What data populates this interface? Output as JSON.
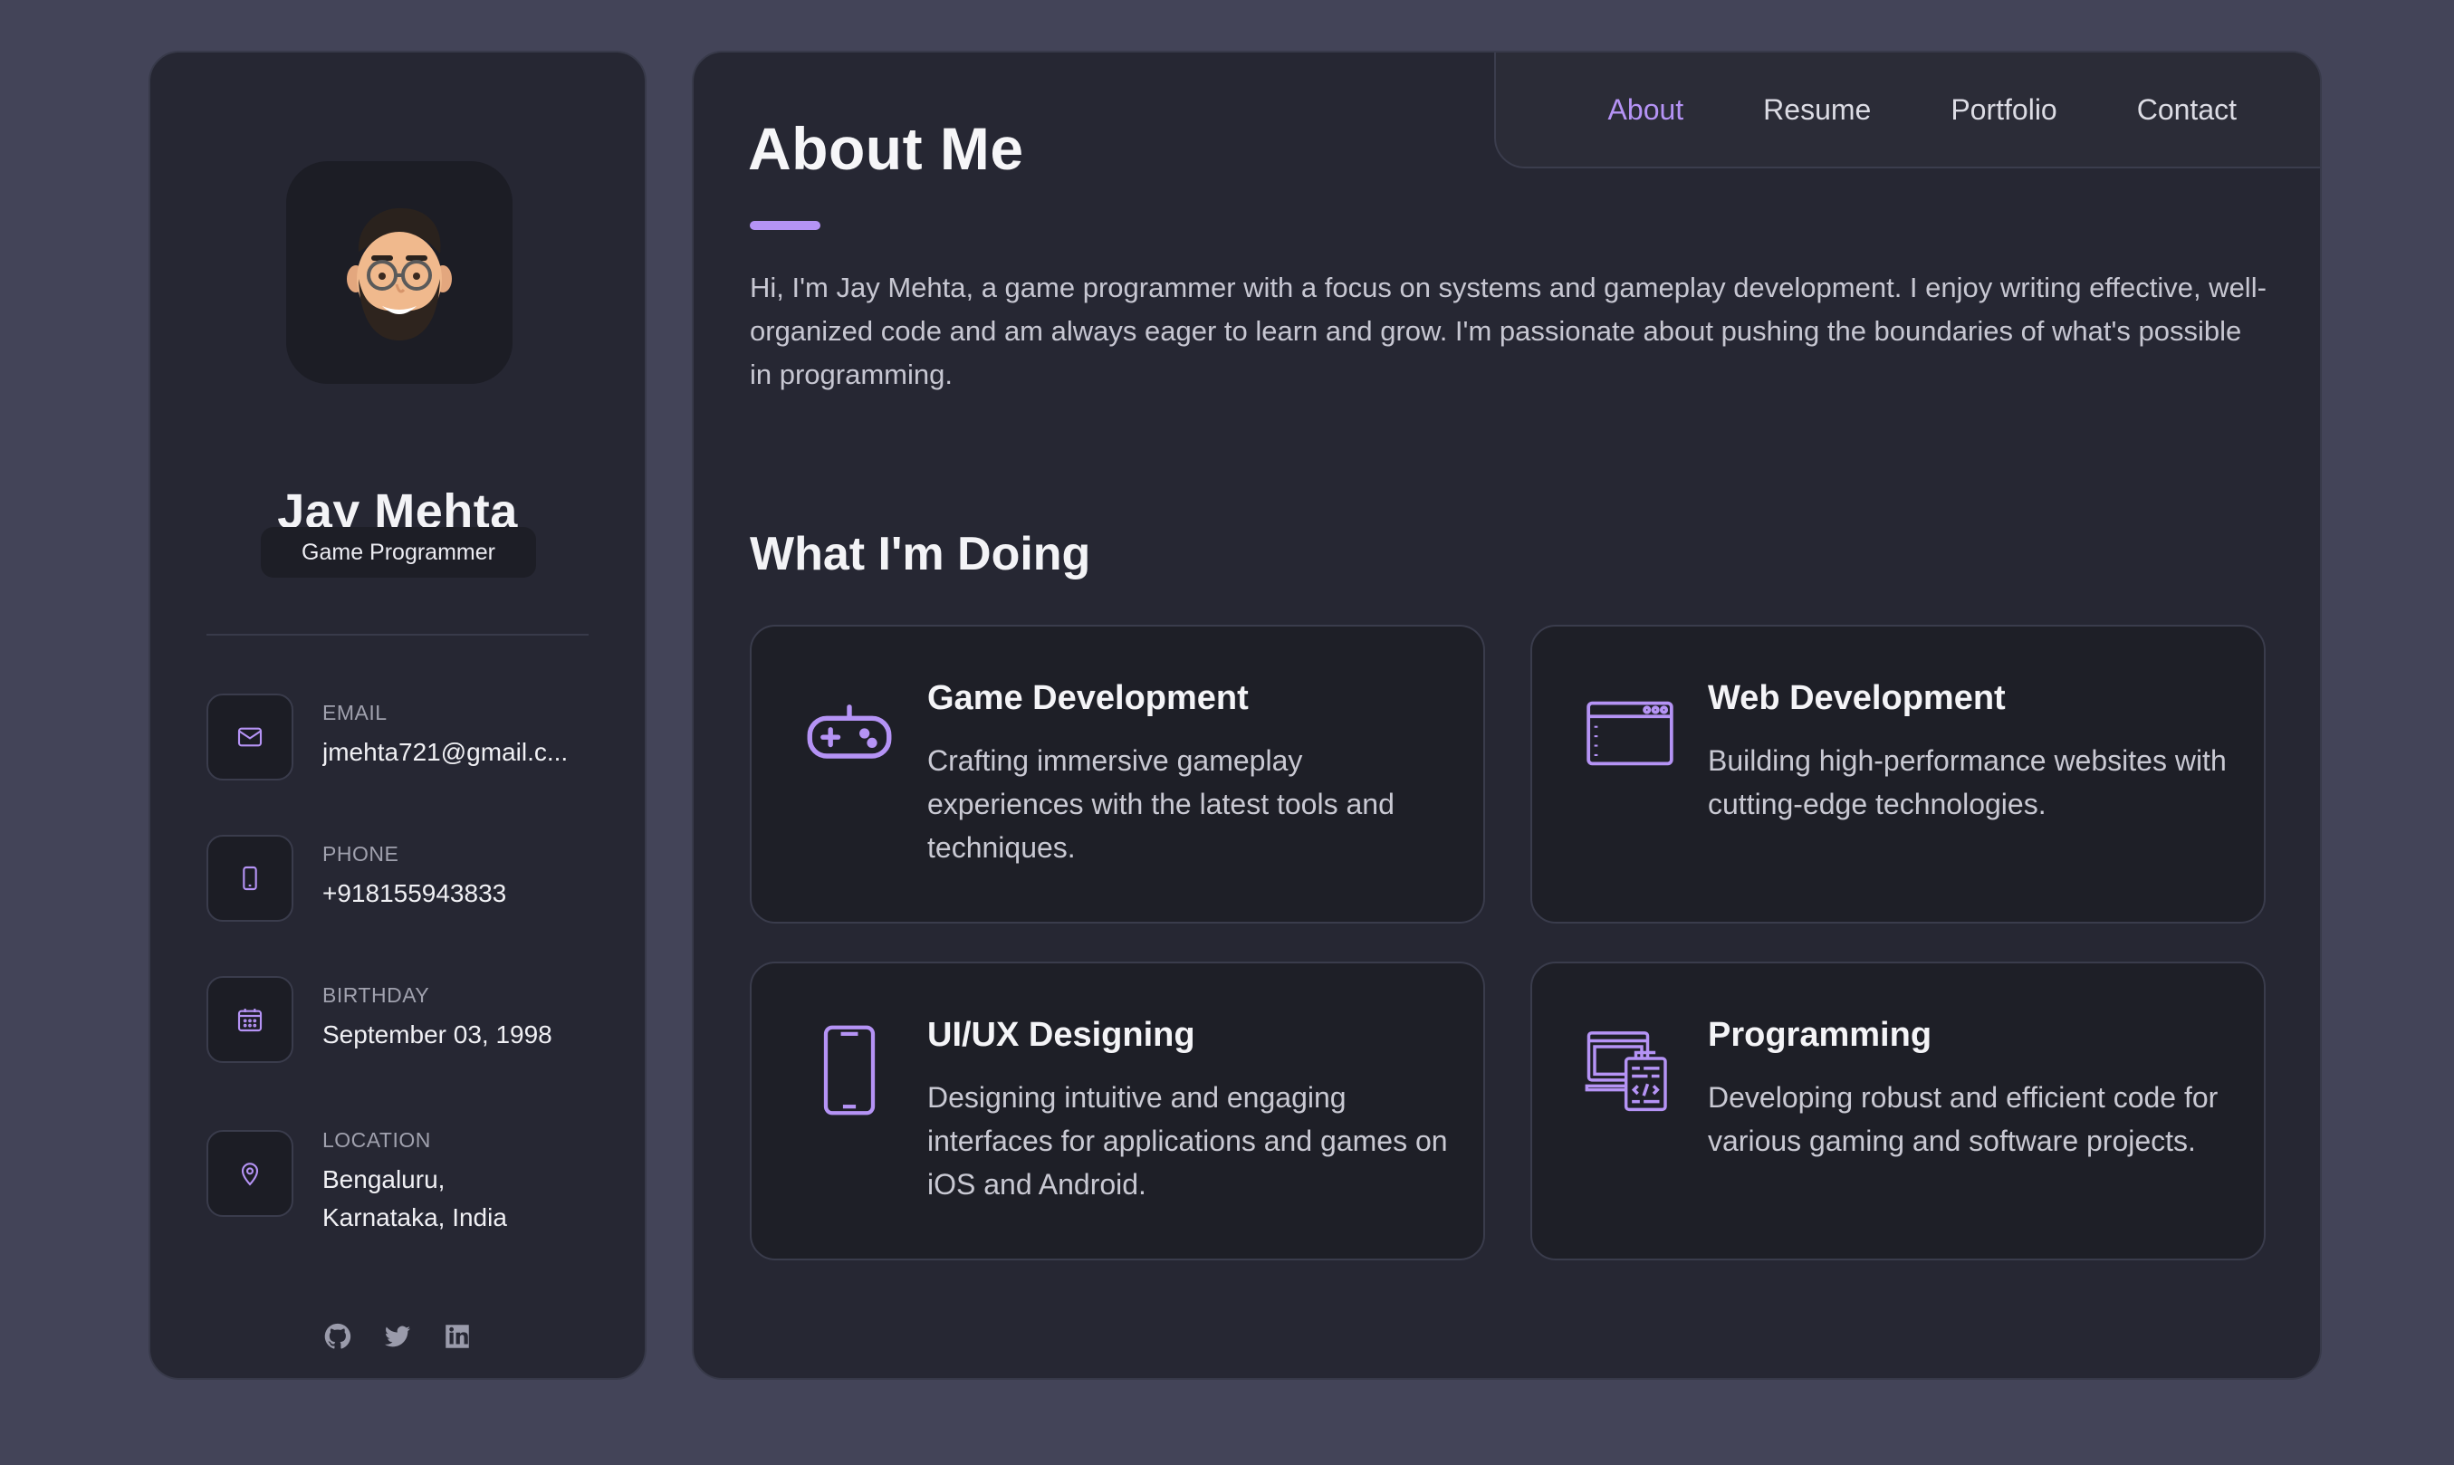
{
  "profile": {
    "name": "Jay Mehta",
    "role": "Game Programmer"
  },
  "contacts": [
    {
      "icon": "mail-icon",
      "label": "EMAIL",
      "value": "jmehta721@gmail.c..."
    },
    {
      "icon": "phone-icon",
      "label": "PHONE",
      "value": "+918155943833"
    },
    {
      "icon": "calendar-icon",
      "label": "BIRTHDAY",
      "value": "September 03, 1998"
    },
    {
      "icon": "location-pin-icon",
      "label": "LOCATION",
      "value": "Bengaluru, Karnataka, India"
    }
  ],
  "socials": [
    "github-icon",
    "twitter-icon",
    "linkedin-icon"
  ],
  "nav": {
    "items": [
      "About",
      "Resume",
      "Portfolio",
      "Contact"
    ],
    "active": "About"
  },
  "about": {
    "title": "About Me",
    "intro": "Hi, I'm Jay Mehta, a game programmer with a focus on systems and gameplay development. I enjoy writing effective, well-organized code and am always eager to learn and grow. I'm passionate about pushing the boundaries of what's possible in programming."
  },
  "services": {
    "title": "What I'm Doing",
    "items": [
      {
        "icon": "gamepad-icon",
        "title": "Game Development",
        "desc": "Crafting immersive gameplay experiences with the latest tools and techniques."
      },
      {
        "icon": "browser-window-icon",
        "title": "Web Development",
        "desc": "Building high-performance websites with cutting-edge technologies."
      },
      {
        "icon": "smartphone-icon",
        "title": "UI/UX Designing",
        "desc": "Designing intuitive and engaging interfaces for applications and games on iOS and Android."
      },
      {
        "icon": "code-monitor-icon",
        "title": "Programming",
        "desc": "Developing robust and efficient code for various gaming and software projects."
      }
    ]
  },
  "colors": {
    "accent": "#b593f5",
    "background": "#434458",
    "card": "#262733",
    "inner_card": "#1e1f27"
  }
}
